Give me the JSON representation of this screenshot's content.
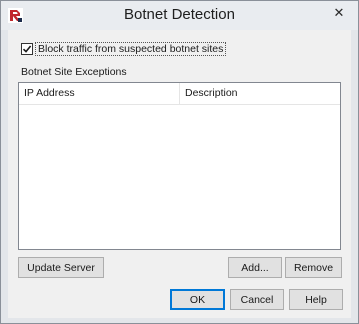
{
  "window": {
    "title": "Botnet Detection",
    "close_glyph": "✕",
    "icon": "watchguard-app-icon"
  },
  "block_traffic": {
    "label": "Block traffic from suspected botnet sites",
    "checked": true
  },
  "exceptions": {
    "section_label": "Botnet Site Exceptions",
    "columns": [
      "IP Address",
      "Description"
    ],
    "rows": []
  },
  "buttons": {
    "update_server": "Update Server",
    "add": "Add...",
    "remove": "Remove",
    "ok": "OK",
    "cancel": "Cancel",
    "help": "Help"
  },
  "colors": {
    "accent": "#0078d7",
    "app_icon_red": "#c1272d"
  }
}
